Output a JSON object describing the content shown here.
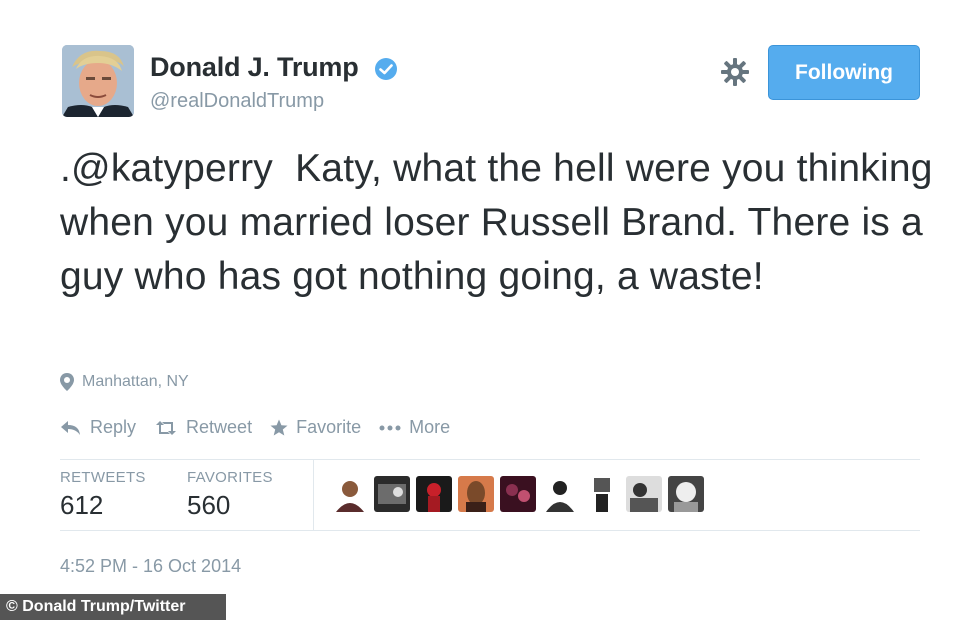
{
  "header": {
    "name": "Donald J. Trump",
    "handle": "@realDonaldTrump",
    "follow_label": "Following",
    "icons": {
      "verified": "verified-badge-icon",
      "settings": "gear-icon"
    }
  },
  "tweet": {
    "mention": ".@katyperry",
    "body": "Katy, what the hell were you thinking when you married loser Russell Brand. There is a guy who has got nothing going, a waste!",
    "location": "Manhattan, NY"
  },
  "actions": [
    {
      "label": "Reply",
      "icon": "reply-icon"
    },
    {
      "label": "Retweet",
      "icon": "retweet-icon"
    },
    {
      "label": "Favorite",
      "icon": "star-icon"
    },
    {
      "label": "More",
      "icon": "more-dots-icon"
    }
  ],
  "stats": {
    "retweets_label": "RETWEETS",
    "retweets": "612",
    "favorites_label": "FAVORITES",
    "favorites": "560"
  },
  "timestamp": "4:52 PM - 16 Oct 2014",
  "credit": "© Donald Trump/Twitter",
  "colors": {
    "accent": "#55acee",
    "text": "#292f33",
    "muted": "#8899a6"
  }
}
